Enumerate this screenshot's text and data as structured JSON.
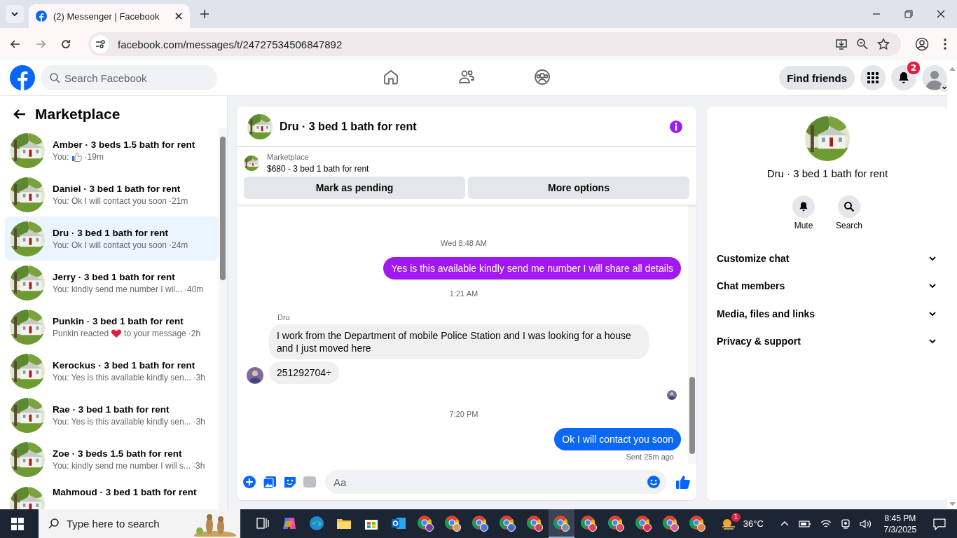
{
  "browser": {
    "tab_title": "(2) Messenger | Facebook",
    "url": "facebook.com/messages/t/24727534506847892"
  },
  "header": {
    "search_placeholder": "Search Facebook",
    "nav": [
      {
        "kind": "home",
        "selected": false
      },
      {
        "kind": "friends",
        "selected": false
      },
      {
        "kind": "groups",
        "selected": false
      }
    ],
    "find_friends": "Find friends",
    "notification_count": "2"
  },
  "sidebar": {
    "title": "Marketplace",
    "conversations": [
      {
        "name": "Amber · 3 beds 1.5 bath for rent",
        "preview": [
          "You:"
        ],
        "kind": "sent_like",
        "time": "·19m",
        "selected": false
      },
      {
        "name": "Daniel · 3 bed 1 bath for rent",
        "preview": [
          "You: Ok I will contact you soon"
        ],
        "time": "·21m",
        "selected": false
      },
      {
        "name": "Dru · 3 bed 1 bath for rent",
        "preview": [
          "You: Ok I will contact you soon"
        ],
        "time": "·24m",
        "selected": true
      },
      {
        "name": "Jerry · 3 bed 1 bath for rent",
        "preview": [
          "You: kindly send me number I wil..."
        ],
        "time": "·40m",
        "selected": false
      },
      {
        "name": "Punkin · 3 bed 1 bath for rent",
        "preview": [
          "Punkin reacted",
          "to your message"
        ],
        "kind": "reaction",
        "time": "·2h",
        "selected": false
      },
      {
        "name": "Kerockus · 3 bed 1 bath for rent",
        "preview": [
          "You: Yes is this available kindly sen..."
        ],
        "time": "·3h",
        "selected": false
      },
      {
        "name": "Rae · 3 bed 1 bath for rent",
        "preview": [
          "You: Yes is this available kindly sen..."
        ],
        "time": "·3h",
        "selected": false
      },
      {
        "name": "Zoe · 3 beds 1.5 bath for rent",
        "preview": [
          "You: kindly send me number I will s..."
        ],
        "time": "·3h",
        "selected": false
      },
      {
        "name": "Mahmoud · 3 bed 1 bath for rent",
        "selected": false
      }
    ]
  },
  "chat": {
    "title": "Dru · 3 bed 1 bath for rent",
    "listing": {
      "label": "Marketplace",
      "title": "$680 - 3 bed 1 bath for rent"
    },
    "actions": [
      "Mark as pending",
      "More options"
    ],
    "messages": [
      {
        "kind": "time",
        "text": "Wed 8:48 AM"
      },
      {
        "kind": "outgoing",
        "text": "Yes is this available kindly send me number I will share all details",
        "color": "#a118f2"
      },
      {
        "kind": "time",
        "text": "1:21 AM"
      },
      {
        "kind": "sender",
        "text": "Dru"
      },
      {
        "kind": "incoming",
        "text": "I work from the Department of mobile Police Station and I was looking for a house and I just moved here"
      },
      {
        "kind": "incoming",
        "text": "251292704÷",
        "avatar": true
      },
      {
        "kind": "seen"
      },
      {
        "kind": "time",
        "text": "7:20 PM"
      },
      {
        "kind": "outgoing",
        "text": "Ok I will contact you soon",
        "color": "#0a68f5"
      },
      {
        "kind": "status",
        "text": "Sent 25m ago"
      }
    ],
    "composer_placeholder": "Aa"
  },
  "details": {
    "title": "Dru · 3 bed 1 bath for rent",
    "actions": [
      {
        "kind": "mute",
        "label": "Mute"
      },
      {
        "kind": "search",
        "label": "Search"
      }
    ],
    "sections": [
      {
        "label": "Customize chat",
        "expanded": false
      },
      {
        "label": "Chat members",
        "expanded": false
      },
      {
        "label": "Media, files and links",
        "expanded": false
      },
      {
        "label": "Privacy & support",
        "expanded": false
      }
    ]
  },
  "taskbar": {
    "search_placeholder": "Type here to search",
    "apps": [
      {
        "kind": "taskview",
        "selected": false
      },
      {
        "kind": "copilot",
        "selected": false
      },
      {
        "kind": "edge",
        "selected": false
      },
      {
        "kind": "explorer",
        "selected": false
      },
      {
        "kind": "store",
        "selected": false
      },
      {
        "kind": "outlook",
        "selected": false
      },
      {
        "kind": "chrome",
        "color": "#6b3fa0",
        "selected": false
      },
      {
        "kind": "chrome",
        "color": "#c8a060",
        "selected": false
      },
      {
        "kind": "chrome",
        "color": "#4a7bd0",
        "selected": false
      },
      {
        "kind": "chrome",
        "color": "#3a6fc0",
        "selected": false
      },
      {
        "kind": "chrome",
        "color": "#d04050",
        "selected": false
      },
      {
        "kind": "chrome",
        "color": "#8090a0",
        "selected": true
      },
      {
        "kind": "chrome",
        "color": "#e04050",
        "selected": false
      },
      {
        "kind": "chrome",
        "color": "#d05060",
        "selected": false
      },
      {
        "kind": "chrome",
        "color": "#e03050",
        "selected": false
      },
      {
        "kind": "chrome",
        "color": "#d06090",
        "selected": false
      },
      {
        "kind": "chrome",
        "color": "#e08040",
        "selected": false
      }
    ],
    "weather_badge": "1",
    "temperature": "36°C",
    "time": "8:45 PM",
    "date": "7/3/2025"
  }
}
